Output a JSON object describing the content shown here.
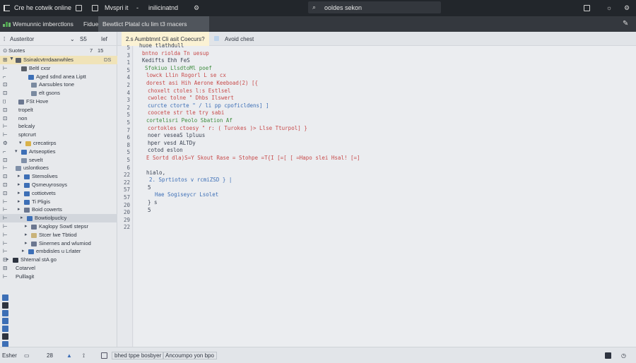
{
  "titlebar": {
    "project": "Cre he cotwik online",
    "menu_a": "Mvspri it",
    "menu_b": "inilicinatnd",
    "search_text": "ooldes sekon"
  },
  "tabbar": {
    "app_label": "Wemunnic imberctlons",
    "tab_files": "Fidues",
    "tab_active": "Bewtlict Platal clu lim t3 rnacers"
  },
  "sidebar": {
    "header_title": "Austeritor",
    "header_s": "S5",
    "header_if": "Ief",
    "sub_label": "Suotes",
    "sub_num": "7",
    "sub_num2": "15",
    "rows": [
      {
        "gut": "12",
        "label": "Ssinalcvtrrdaanwhles",
        "extra": "DS"
      },
      {
        "gut": "",
        "label": "Beltl cxsr",
        "extra": ""
      },
      {
        "gut": "",
        "label": "Aged sdnd anea Liptt",
        "extra": ""
      },
      {
        "gut": "",
        "label": "Aarsubles tone",
        "extra": ""
      },
      {
        "gut": "",
        "label": "elt gsons",
        "extra": ""
      },
      {
        "gut": "",
        "label": "FSt Hove",
        "extra": ""
      },
      {
        "gut": "",
        "label": "tropelt",
        "extra": ""
      },
      {
        "gut": "",
        "label": "non",
        "extra": ""
      },
      {
        "gut": "",
        "label": "belcaly",
        "extra": ""
      },
      {
        "gut": "",
        "label": "sptcrurt",
        "extra": ""
      },
      {
        "gut": "",
        "label": "crecatirps",
        "extra": ""
      },
      {
        "gut": "",
        "label": "Artseopties",
        "extra": ""
      },
      {
        "gut": "",
        "label": "sevelt",
        "extra": ""
      },
      {
        "gut": "",
        "label": "uslontkoes",
        "extra": ""
      },
      {
        "gut": "",
        "label": "Stemolives",
        "extra": ""
      },
      {
        "gut": "",
        "label": "Qsmeuyrosoys",
        "extra": ""
      },
      {
        "gut": "",
        "label": "cottiotvets",
        "extra": ""
      },
      {
        "gut": "",
        "label": "Ti Pligis",
        "extra": ""
      },
      {
        "gut": "",
        "label": "Boid cowerts",
        "extra": ""
      },
      {
        "gut": "",
        "label": "Bowtiolpuclcy",
        "extra": ""
      },
      {
        "gut": "",
        "label": "Kaglopy Sowtl stepsr",
        "extra": ""
      },
      {
        "gut": "",
        "label": "Stcer lwe Tbtiod",
        "extra": ""
      },
      {
        "gut": "",
        "label": "Sinernes and wlumiod",
        "extra": ""
      },
      {
        "gut": "",
        "label": "embdisles u Lrlater",
        "extra": ""
      },
      {
        "gut": "",
        "label": "Shternal stA go",
        "extra": ""
      },
      {
        "gut": "",
        "label": "Cotarvel",
        "extra": ""
      },
      {
        "gut": "",
        "label": "Pulllagit",
        "extra": ""
      }
    ]
  },
  "editor": {
    "tab_active": "2.s Aumbtmnt Cli asit Coecurs?",
    "tab_other": "Avoid chest",
    "line_numbers": [
      "5",
      "3",
      "1",
      "5",
      "4",
      "2",
      "4",
      "3",
      "2",
      "5",
      "5",
      "7",
      "6",
      "8",
      "5",
      "5",
      "6",
      "22",
      "22",
      "57",
      "57",
      "20",
      "20",
      "29",
      "22"
    ],
    "lines": [
      "huoe tlathdull",
      "bntno riolda  Tn uesup",
      "Kedifts Ehh  FeS",
      "Sfokiuo LlsdtoMl  poef ",
      "lowck  Llin  Rogorl L se  cx",
      "dorest  asi  Hih  Aerone  Keeboad(2) [{",
      "choxelt  ctoles       l:s  Estlsel",
      "cwolec  tolne  \" Dhbs   Ilswert",
      "curcte  ctorte  \" / li  pp cpoficldens] ]",
      "coocete  str tle  try  sabi",
      "cortelisri  Peolo   Sbation  Af",
      "cortokles  ctoesy  \" r:  ( Turokes  )>  Llse  Tturpol] }",
      "noer  veseaS  lpluus",
      "hper  vesd  ALTDy",
      "cotod  eslon",
      "E  Sortd  dla)S=Y  Skout  Rase  =  Stohpe  =T{I  [=[ [  =Hapo  slei  Hsal! [=]",
      "hialo,",
      "2.  Sprtiotos  v  rcmiZSD  }  |",
      "5",
      "Hae  Sogiseycr  Lsolet",
      "} s",
      "5"
    ]
  },
  "statusbar": {
    "left": "Esher",
    "n1": "28",
    "item_a": "bhed tppe bosbyer",
    "item_b": "Ancoumpo yon bpo"
  },
  "colors": {
    "titlebar": "#22262b",
    "tabbar": "#34383e",
    "selection": "#f0e3b8",
    "accent_blue": "#3d6fb6",
    "accent_red": "#c74a4a",
    "accent_green": "#3f8d3f"
  }
}
